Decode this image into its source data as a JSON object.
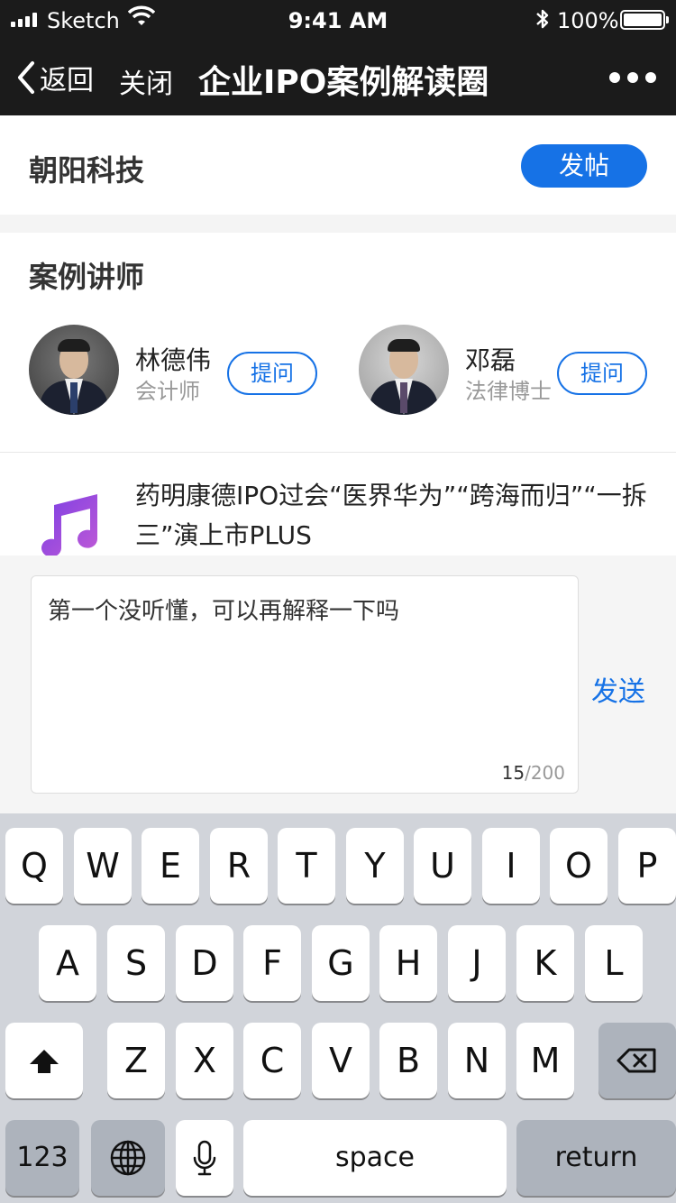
{
  "status_bar": {
    "carrier": "Sketch",
    "time": "9:41 AM",
    "battery": "100%",
    "icons": [
      "signal-icon",
      "wifi-icon",
      "bluetooth-icon",
      "battery-icon"
    ]
  },
  "nav": {
    "back_label": "返回",
    "close_label": "关闭",
    "title": "企业IPO案例解读圈",
    "more_icon": "more-dots-icon"
  },
  "company": {
    "name": "朝阳科技",
    "post_label": "发帖"
  },
  "lecturers": {
    "heading": "案例讲师",
    "items": [
      {
        "name": "林德伟",
        "role": "会计师",
        "ask_label": "提问"
      },
      {
        "name": "邓磊",
        "role": "法律博士",
        "ask_label": "提问"
      }
    ]
  },
  "article": {
    "icon": "music-note-icon",
    "title": "药明康德IPO过会“医界华为”“跨海而归”“一拆三”演上市PLUS"
  },
  "reply": {
    "text": "第一个没听懂，可以再解释一下吗",
    "count_current": "15",
    "count_max": "/200",
    "send_label": "发送"
  },
  "keyboard": {
    "row1": [
      "Q",
      "W",
      "E",
      "R",
      "T",
      "Y",
      "U",
      "I",
      "O",
      "P"
    ],
    "row2": [
      "A",
      "S",
      "D",
      "F",
      "G",
      "H",
      "J",
      "K",
      "L"
    ],
    "row3": [
      "Z",
      "X",
      "C",
      "V",
      "B",
      "N",
      "M"
    ],
    "numbers_label": "123",
    "space_label": "space",
    "return_label": "return",
    "icons": [
      "shift-icon",
      "backspace-icon",
      "globe-icon",
      "microphone-icon"
    ]
  },
  "colors": {
    "accent": "#1672e6",
    "nav_bg": "#1b1b1b",
    "keyboard_bg": "#d1d4da"
  }
}
